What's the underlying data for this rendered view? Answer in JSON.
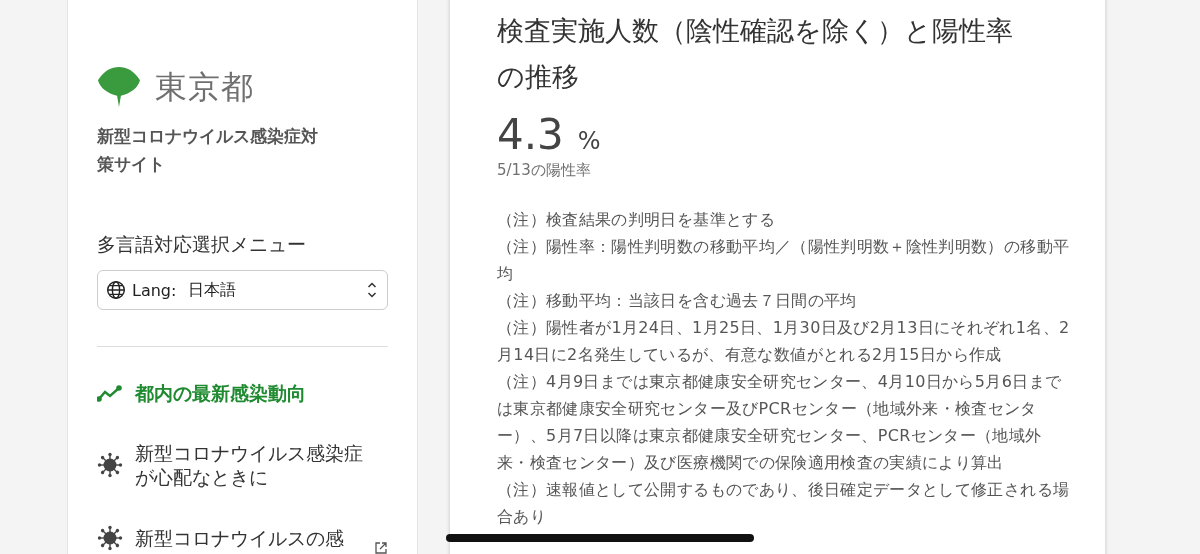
{
  "sidebar": {
    "logo_text": "東京都",
    "site_title": "新型コロナウイルス感染症対策サイト",
    "language_menu": {
      "label": "多言語対応選択メニュー",
      "prefix": "Lang:",
      "value": "日本語"
    },
    "nav_items": [
      {
        "kind": "trend",
        "label": "都内の最新感染動向",
        "selected": true,
        "external": false
      },
      {
        "kind": "virus",
        "label": "新型コロナウイルス感染症が心配なときに",
        "selected": false,
        "external": false
      },
      {
        "kind": "virus",
        "label": "新型コロナウイルスの感",
        "selected": false,
        "external": true
      }
    ]
  },
  "card": {
    "title": "検査実施人数（陰性確認を除く）と陽性率の推移",
    "value": "4.3",
    "unit": "%",
    "caption": "5/13の陽性率",
    "notes": [
      "（注）検査結果の判明日を基準とする",
      "（注）陽性率：陽性判明数の移動平均／（陽性判明数＋陰性判明数）の移動平均",
      "（注）移動平均：当該日を含む過去７日間の平均",
      "（注）陽性者が1月24日、1月25日、1月30日及び2月13日にそれぞれ1名、2月14日に2名発生しているが、有意な数値がとれる2月15日から作成",
      "（注）4月9日までは東京都健康安全研究センター、4月10日から5月6日までは東京都健康安全研究センター及びPCRセンター（地域外来・検査センター）、5月7日以降は東京都健康安全研究センター、PCRセンター（地域外来・検査センター）及び医療機関での保険適用検査の実績により算出",
      "（注）速報値として公開するものであり、後日確定データとして修正される場合あり"
    ]
  }
}
